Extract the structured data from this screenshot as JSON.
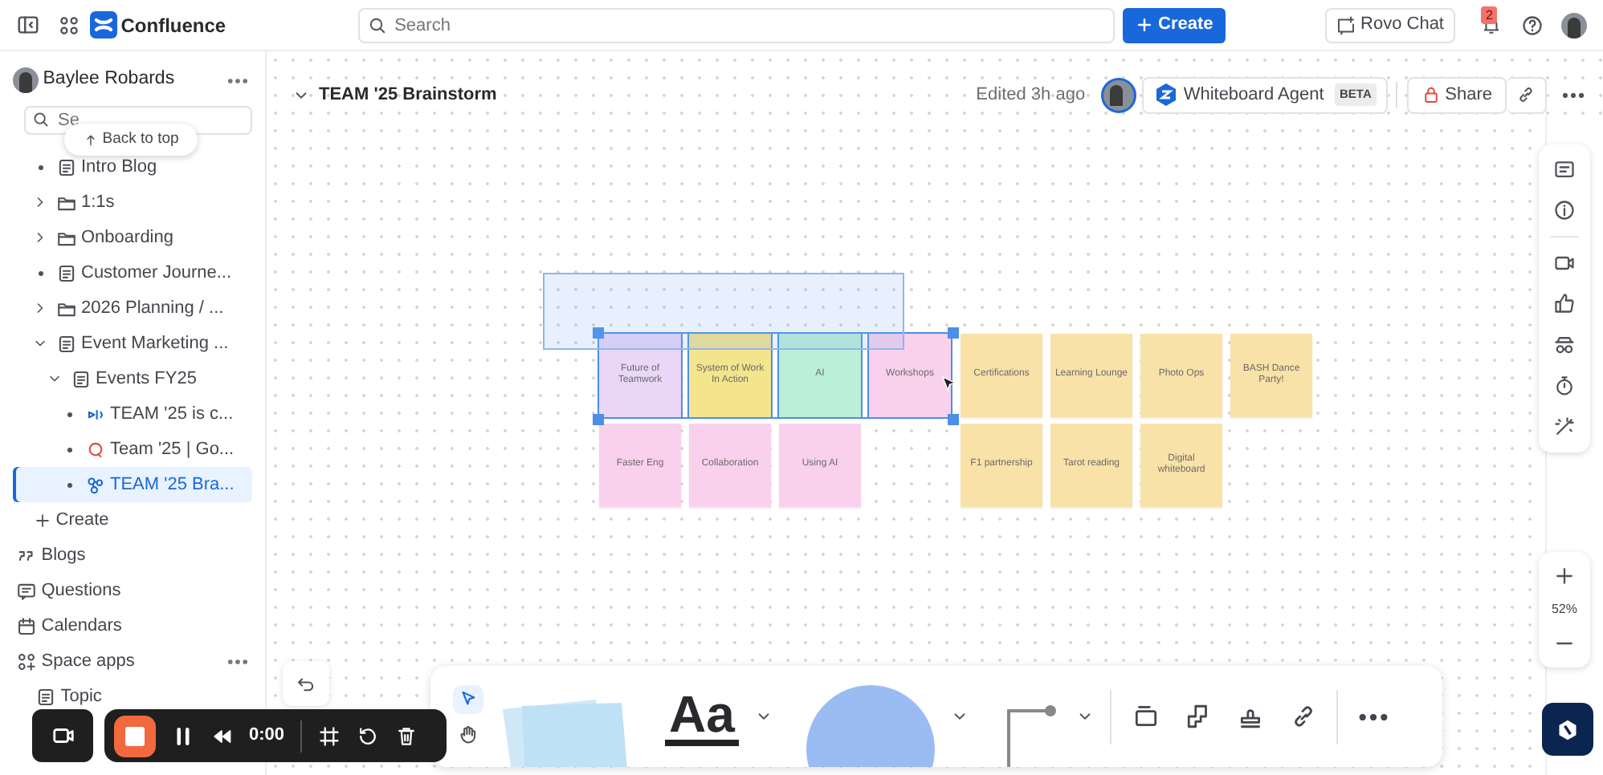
{
  "topbar": {
    "product": "Confluence",
    "search_placeholder": "Search",
    "create_button": "Create",
    "rovo_button": "Rovo Chat",
    "notification_count": "2"
  },
  "sidebar": {
    "space_owner": "Baylee Robards",
    "search_placeholder": "Se",
    "back_to_top": "Back to top",
    "tree": [
      {
        "label": "Intro Blog",
        "kind": "page",
        "selected": false
      },
      {
        "label": "1:1s",
        "kind": "folder",
        "expanded": false,
        "selected": false
      },
      {
        "label": "Onboarding",
        "kind": "folder",
        "expanded": false,
        "selected": false
      },
      {
        "label": "Customer Journe...",
        "kind": "page",
        "selected": false
      },
      {
        "label": "2026 Planning / ...",
        "kind": "folder",
        "expanded": false,
        "selected": false
      },
      {
        "label": "Event Marketing ...",
        "kind": "page",
        "expanded": true,
        "selected": false,
        "children": [
          {
            "label": "Events FY25",
            "kind": "page",
            "expanded": true,
            "selected": false,
            "children": [
              {
                "label": "TEAM '25 is c...",
                "kind": "event",
                "selected": false
              },
              {
                "label": "Team '25 | Go...",
                "kind": "quiz",
                "selected": false
              },
              {
                "label": "TEAM '25 Bra...",
                "kind": "whiteboard",
                "selected": true
              }
            ]
          }
        ]
      }
    ],
    "create_label": "Create",
    "nav": [
      {
        "label": "Blogs",
        "kind": "blogs"
      },
      {
        "label": "Questions",
        "kind": "questions"
      },
      {
        "label": "Calendars",
        "kind": "calendar"
      },
      {
        "label": "Space apps",
        "kind": "apps"
      },
      {
        "label": "Topic",
        "kind": "page"
      }
    ]
  },
  "board": {
    "title": "TEAM '25 Brainstorm",
    "edited": "Edited 3h ago",
    "agent_button": "Whiteboard Agent",
    "agent_badge": "BETA",
    "share_button": "Share",
    "zoom": "52%",
    "note_groups": [
      {
        "rows": [
          [
            {
              "label": "Future of Teamwork",
              "color": "#ead6f7",
              "selected": true
            },
            {
              "label": "System of Work In Action",
              "color": "#f4e48c",
              "selected": true
            },
            {
              "label": "AI",
              "color": "#bcefd7",
              "selected": true
            },
            {
              "label": "Workshops",
              "color": "#f9d1ec",
              "selected": true
            }
          ],
          [
            {
              "label": "Faster Eng",
              "color": "#f9d1ec",
              "selected": false
            },
            {
              "label": "Collaboration",
              "color": "#f9d1ec",
              "selected": false
            },
            {
              "label": "Using AI",
              "color": "#f9d1ec",
              "selected": false
            }
          ]
        ]
      },
      {
        "rows": [
          [
            {
              "label": "Certifications",
              "color": "#f9e2a8",
              "selected": false
            },
            {
              "label": "Learning Lounge",
              "color": "#f9e2a8",
              "selected": false
            },
            {
              "label": "Photo Ops",
              "color": "#f9e2a8",
              "selected": false
            },
            {
              "label": "BASH Dance Party!",
              "color": "#f9e2a8",
              "selected": false
            }
          ],
          [
            {
              "label": "F1 partnership",
              "color": "#f9e2a8",
              "selected": false
            },
            {
              "label": "Tarot reading",
              "color": "#f9e2a8",
              "selected": false
            },
            {
              "label": "Digital whiteboard",
              "color": "#f9e2a8",
              "selected": false
            }
          ]
        ]
      }
    ]
  },
  "toolbar": {
    "tools": [
      {
        "kind": "select",
        "selected": true
      },
      {
        "kind": "hand",
        "selected": false
      }
    ],
    "text_sample": "Aa"
  },
  "recorder": {
    "time": "0:00"
  }
}
